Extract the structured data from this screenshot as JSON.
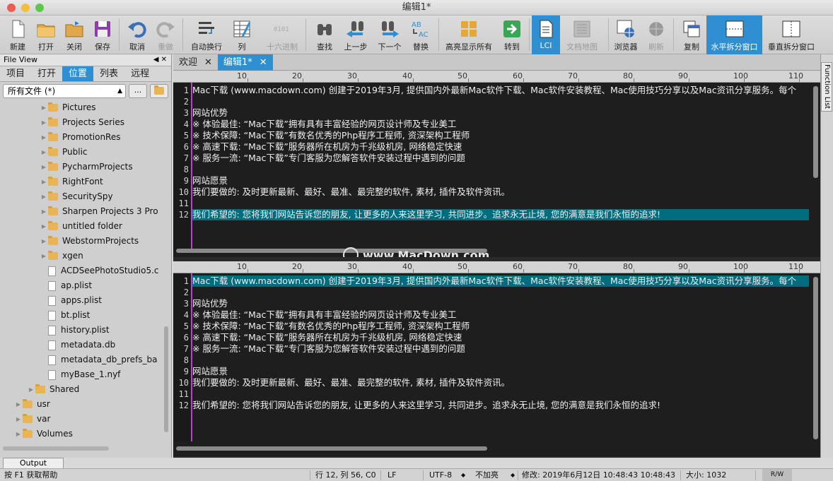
{
  "window": {
    "title": "编辑1*"
  },
  "toolbar": {
    "new": "新建",
    "open": "打开",
    "close": "关闭",
    "save": "保存",
    "undo": "取消",
    "redo": "重做",
    "wrap": "自动换行",
    "column": "列",
    "hex": "十六进制",
    "find": "查找",
    "prev": "上一步",
    "next": "下一个",
    "replace": "替换",
    "highlight_all": "高亮显示所有",
    "goto": "转到",
    "lci": "LCI",
    "docmap": "文档地图",
    "browser": "浏览器",
    "refresh": "刷新",
    "copy": "复制",
    "hsplit": "水平拆分窗口",
    "vsplit": "垂直拆分窗口"
  },
  "sidebar": {
    "header": "File View",
    "tabs": [
      "项目",
      "打开",
      "位置",
      "列表",
      "远程"
    ],
    "active_tab": "位置",
    "filter": "所有文件 (*)",
    "dots": "...",
    "tree": [
      {
        "name": "Pictures",
        "type": "folder",
        "level": 2
      },
      {
        "name": "Projects Series",
        "type": "folder",
        "level": 2
      },
      {
        "name": "PromotionRes",
        "type": "folder",
        "level": 2
      },
      {
        "name": "Public",
        "type": "folder",
        "level": 2
      },
      {
        "name": "PycharmProjects",
        "type": "folder",
        "level": 2
      },
      {
        "name": "RightFont",
        "type": "folder",
        "level": 2
      },
      {
        "name": "SecuritySpy",
        "type": "folder",
        "level": 2
      },
      {
        "name": "Sharpen Projects 3 Pro",
        "type": "folder",
        "level": 2
      },
      {
        "name": "untitled folder",
        "type": "folder",
        "level": 2
      },
      {
        "name": "WebstormProjects",
        "type": "folder",
        "level": 2
      },
      {
        "name": "xgen",
        "type": "folder",
        "level": 2
      },
      {
        "name": "ACDSeePhotoStudio5.c",
        "type": "file",
        "level": 2
      },
      {
        "name": "ap.plist",
        "type": "file",
        "level": 2
      },
      {
        "name": "apps.plist",
        "type": "file",
        "level": 2
      },
      {
        "name": "bt.plist",
        "type": "file",
        "level": 2
      },
      {
        "name": "history.plist",
        "type": "file",
        "level": 2
      },
      {
        "name": "metadata.db",
        "type": "file",
        "level": 2
      },
      {
        "name": "metadata_db_prefs_ba",
        "type": "file",
        "level": 2
      },
      {
        "name": "myBase_1.nyf",
        "type": "file",
        "level": 2
      },
      {
        "name": "Shared",
        "type": "folder",
        "level": 1
      },
      {
        "name": "usr",
        "type": "folder",
        "level": 0
      },
      {
        "name": "var",
        "type": "folder",
        "level": 0
      },
      {
        "name": "Volumes",
        "type": "folder",
        "level": 0
      }
    ],
    "output_tab": "Output Window"
  },
  "editor": {
    "tabs": [
      {
        "label": "欢迎"
      },
      {
        "label": "编辑1*"
      }
    ],
    "close_glyph": "✕",
    "ruler": [
      "10",
      "20",
      "30",
      "40",
      "50",
      "60",
      "70",
      "80",
      "90",
      "100",
      "110"
    ],
    "lines": [
      "Mac下载 (www.macdown.com) 创建于2019年3月, 提供国内外最新Mac软件下载、Mac软件安装教程、Mac使用技巧分享以及Mac资讯分享服务。每个",
      "",
      "网站优势",
      "※ 体验最佳: “Mac下载”拥有具有丰富经验的网页设计师及专业美工",
      "※ 技术保障: “Mac下载”有数名优秀的Php程序工程师, 资深架构工程师",
      "※ 高速下载: “Mac下载”服务器所在机房为千兆级机房, 网络稳定快速",
      "※ 服务一流: “Mac下载”专门客服为您解答软件安装过程中遇到的问题",
      "",
      "网站愿景",
      "我们要做的: 及时更新最新、最好、最准、最完整的软件, 素材, 插件及软件资讯。",
      "",
      "我们希望的: 您将我们网站告诉您的朋友, 让更多的人来这里学习, 共同进步。追求永无止境, 您的满意是我们永恒的追求!"
    ],
    "watermark": "www.MacDown.com"
  },
  "right_panel": {
    "function_list": "Function List"
  },
  "status": {
    "help": "按 F1 获取帮助",
    "position": "行 12, 列 56, C0",
    "eol": "LF",
    "encoding": "UTF-8",
    "highlight": "不加亮",
    "modified": "修改: 2019年6月12日 10:48:43 10:48:43",
    "size": "大小: 1032",
    "mode": "R/W"
  }
}
